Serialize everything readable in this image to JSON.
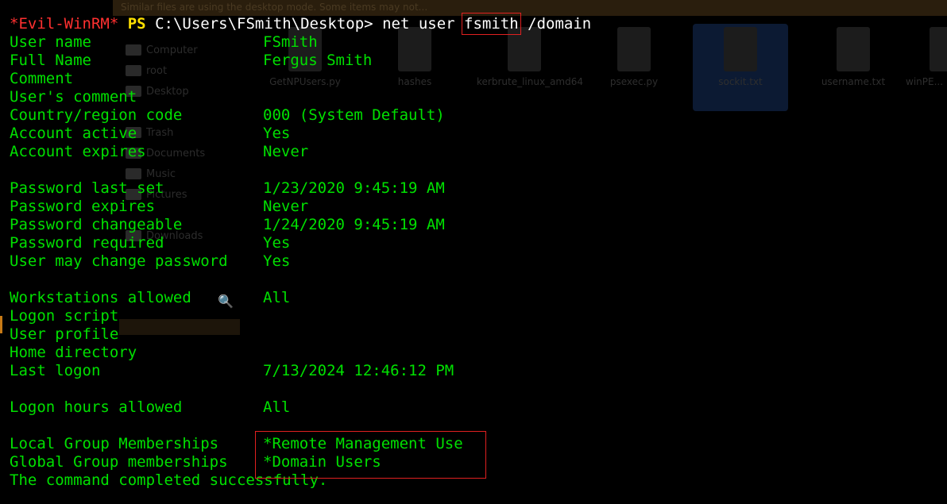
{
  "background_ui": {
    "top_bar_text": "Similar files are using the desktop mode. Some items may not...",
    "sidebar": [
      {
        "label": "Computer"
      },
      {
        "label": "root"
      },
      {
        "label": "Desktop"
      },
      {
        "label": "Trash"
      },
      {
        "label": "Documents"
      },
      {
        "label": "Music"
      },
      {
        "label": "Pictures"
      },
      {
        "label": "Downloads"
      }
    ],
    "files": [
      {
        "name": "GetNPUsers.py"
      },
      {
        "name": "hashes"
      },
      {
        "name": "kerbrute_linux_amd64"
      },
      {
        "name": "psexec.py"
      },
      {
        "name": "sockit.txt"
      },
      {
        "name": "username.txt"
      },
      {
        "name": "winPE..."
      }
    ]
  },
  "terminal": {
    "prompt": {
      "shell": "*Evil-WinRM*",
      "ps": "PS",
      "path": "C:\\Users\\FSmith\\Desktop>",
      "command_prefix": "net user",
      "highlighted_arg": "fsmith",
      "command_suffix": "/domain"
    },
    "fields": [
      {
        "label": "User name",
        "value": "FSmith"
      },
      {
        "label": "Full Name",
        "value": "Fergus Smith"
      },
      {
        "label": "Comment",
        "value": ""
      },
      {
        "label": "User's comment",
        "value": ""
      },
      {
        "label": "Country/region code",
        "value": "000 (System Default)"
      },
      {
        "label": "Account active",
        "value": "Yes"
      },
      {
        "label": "Account expires",
        "value": "Never"
      },
      {
        "label": "",
        "value": ""
      },
      {
        "label": "Password last set",
        "value": "1/23/2020 9:45:19 AM"
      },
      {
        "label": "Password expires",
        "value": "Never"
      },
      {
        "label": "Password changeable",
        "value": "1/24/2020 9:45:19 AM"
      },
      {
        "label": "Password required",
        "value": "Yes"
      },
      {
        "label": "User may change password",
        "value": "Yes"
      },
      {
        "label": "",
        "value": ""
      },
      {
        "label": "Workstations allowed",
        "value": "All"
      },
      {
        "label": "Logon script",
        "value": ""
      },
      {
        "label": "User profile",
        "value": ""
      },
      {
        "label": "Home directory",
        "value": ""
      },
      {
        "label": "Last logon",
        "value": "7/13/2024 12:46:12 PM"
      },
      {
        "label": "",
        "value": ""
      },
      {
        "label": "Logon hours allowed",
        "value": "All"
      },
      {
        "label": "",
        "value": ""
      },
      {
        "label": "Local Group Memberships",
        "value": "*Remote Management Use"
      },
      {
        "label": "Global Group memberships",
        "value": "*Domain Users"
      }
    ],
    "completion_message": "The command completed successfully."
  },
  "colors": {
    "text_green": "#00e000",
    "prompt_red": "#ff3030",
    "prompt_yellow": "#ffe000",
    "highlight_red": "#e02020",
    "background": "#000000"
  }
}
